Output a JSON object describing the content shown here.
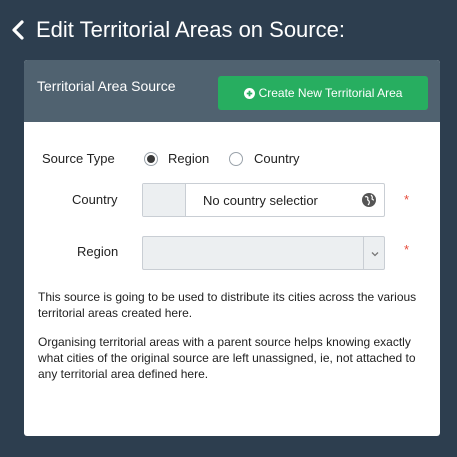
{
  "header": {
    "title": "Edit Territorial Areas on Source:"
  },
  "panel": {
    "title": "Territorial Area Source",
    "create_button_label": "Create New Territorial Area"
  },
  "form": {
    "source_type_label": "Source Type",
    "source_type_options": [
      "Region",
      "Country"
    ],
    "source_type_selected": "Region",
    "country_label": "Country",
    "country_value": "No country selectior",
    "region_label": "Region",
    "region_value": "",
    "required_marker": "*"
  },
  "help": {
    "para1": "This source is going to be used to distribute its cities across the various territorial areas created here.",
    "para2": "Organising territorial areas with a parent source helps knowing exactly what cities of the original source are left unassigned, ie, not attached to any territorial area defined here."
  },
  "icons": {
    "back": "chevron-left-icon",
    "plus": "plus-circle-icon",
    "globe": "globe-icon",
    "dropdown": "chevron-down-icon"
  },
  "colors": {
    "background": "#2d3e4f",
    "panel_header": "#506270",
    "create_button": "#27ae60",
    "required": "#e74c3c"
  }
}
